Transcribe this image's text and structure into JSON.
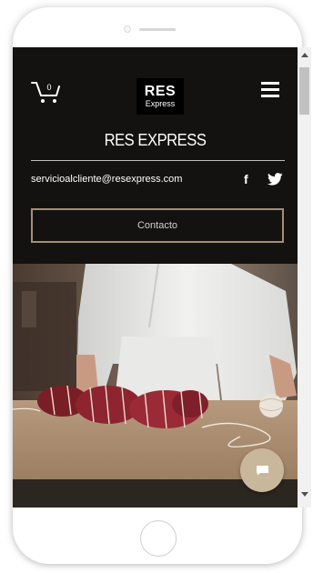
{
  "header": {
    "logo": {
      "line1": "RES",
      "line2": "Express"
    },
    "site_title": "RES EXPRESS",
    "cart_count": "0",
    "email": "servicioalcliente@resexpress.com",
    "social": {
      "facebook": "f"
    },
    "contact_label": "Contacto"
  },
  "hero": {
    "icon": "butcher-tying-meat-image"
  },
  "chat": {
    "icon": "chat-icon"
  },
  "colors": {
    "background": "#141210",
    "accent": "#a38f77",
    "chat_button": "#c9b79c"
  }
}
